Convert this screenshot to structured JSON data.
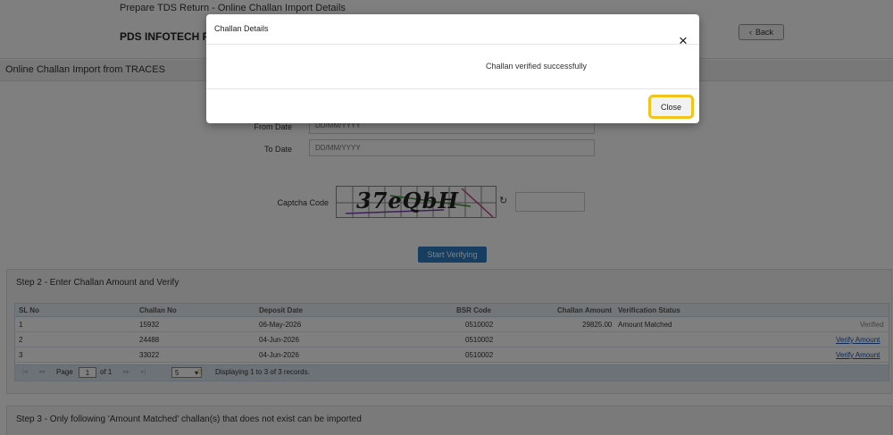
{
  "header": {
    "breadcrumb": "Prepare TDS Return - Online Challan Import Details",
    "company": "PDS INFOTECH PRIVATE LIMITED",
    "back_label": "Back"
  },
  "section_title": "Online Challan Import from TRACES",
  "form": {
    "from_date_label": "From Date",
    "from_date_placeholder": "DD/MM/YYYY",
    "to_date_label": "To Date",
    "to_date_placeholder": "DD/MM/YYYY",
    "captcha_label": "Captcha Code",
    "captcha_text": "37eQbH",
    "start_button": "Start Verifying"
  },
  "step2": {
    "title": "Step 2 - Enter Challan Amount and Verify",
    "columns": [
      "SL No",
      "Challan No",
      "Deposit Date",
      "BSR Code",
      "Challan Amount",
      "Verification Status"
    ],
    "rows": [
      {
        "sl": "1",
        "challan_no": "15932",
        "deposit_date": "06-May-2026",
        "bsr": "0510002",
        "amount": "29825.00",
        "status": "Amount Matched",
        "action": "Verified"
      },
      {
        "sl": "2",
        "challan_no": "24488",
        "deposit_date": "04-Jun-2026",
        "bsr": "0510002",
        "amount": "",
        "status": "",
        "action": "Verify Amount"
      },
      {
        "sl": "3",
        "challan_no": "33022",
        "deposit_date": "04-Jun-2026",
        "bsr": "0510002",
        "amount": "",
        "status": "",
        "action": "Verify Amount"
      }
    ],
    "pager": {
      "page_label": "Page",
      "page_value": "1",
      "of_label": "of 1",
      "page_size": "5",
      "records_text": "Displaying 1 to 3 of 3 records."
    }
  },
  "step3": {
    "title": "Step 3 - Only following 'Amount Matched' challan(s) that does not exist can be imported"
  },
  "modal": {
    "title": "Challan Details",
    "message": "Challan verified successfully",
    "close_button": "Close",
    "close_icon": "×"
  },
  "colors": {
    "primary_button": "#2f7cc2",
    "highlight": "#f0c419",
    "link": "#1a57b3"
  }
}
